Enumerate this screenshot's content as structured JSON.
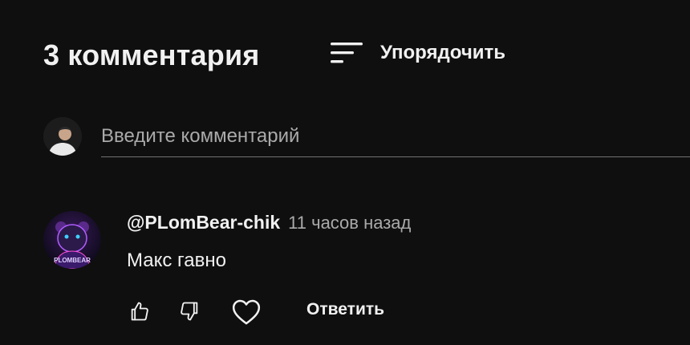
{
  "header": {
    "comment_count_label": "3 комментария",
    "sort_label": "Упорядочить",
    "sort_icon": "sort-icon"
  },
  "composer": {
    "placeholder": "Введите комментарий",
    "avatar_icon": "user-avatar"
  },
  "comments": [
    {
      "author": "@PLomBear-chik",
      "time": "11 часов назад",
      "text": "Макс гавно",
      "avatar_text": "PLOMBEAR",
      "actions": {
        "like_icon": "thumbs-up-icon",
        "dislike_icon": "thumbs-down-icon",
        "heart_icon": "heart-icon",
        "reply_label": "Ответить"
      }
    }
  ],
  "colors": {
    "background": "#0f0f0f",
    "text": "#f1f1f1",
    "secondary_text": "#aaaaaa",
    "divider": "#717171",
    "avatar_accent": "#b05cff"
  }
}
